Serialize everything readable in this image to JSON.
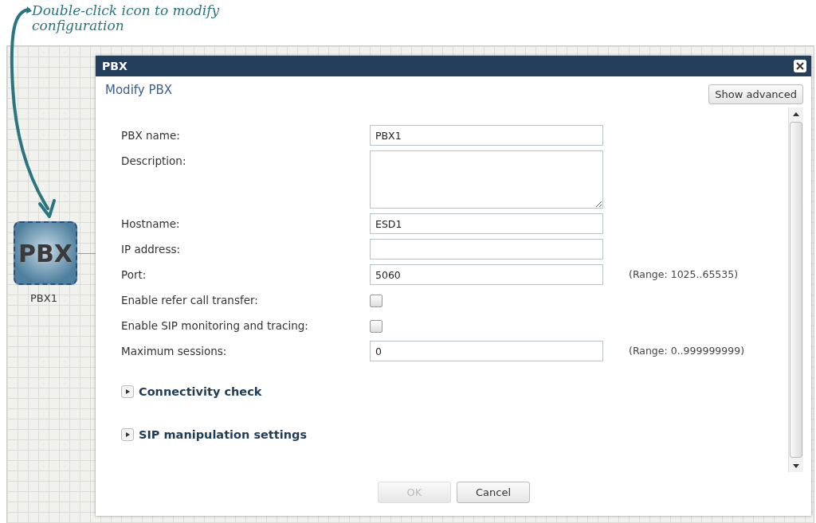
{
  "annotation": {
    "text": "Double-click icon to modify configuration"
  },
  "node": {
    "label": "PBX",
    "name": "PBX1"
  },
  "dialog": {
    "title": "PBX",
    "heading": "Modify PBX",
    "advanced_button": "Show advanced",
    "fields": [
      {
        "kind": "text",
        "label": "PBX name:",
        "value": "PBX1"
      },
      {
        "kind": "textarea",
        "label": "Description:"
      },
      {
        "kind": "text",
        "label": "Hostname:",
        "value": "ESD1"
      },
      {
        "kind": "text",
        "label": "IP address:"
      },
      {
        "kind": "text",
        "label": "Port:",
        "value": "5060",
        "hint": "(Range: 1025..65535)"
      },
      {
        "kind": "checkbox",
        "label": "Enable refer call transfer:",
        "checked": false
      },
      {
        "kind": "checkbox",
        "label": "Enable SIP monitoring and tracing:",
        "checked": false
      },
      {
        "kind": "text",
        "label": "Maximum sessions:",
        "value": "0",
        "hint": "(Range: 0..999999999)"
      }
    ],
    "sections": [
      {
        "title": "Connectivity check",
        "expanded": false
      },
      {
        "title": "SIP manipulation settings",
        "expanded": false
      }
    ],
    "buttons": [
      {
        "label": "OK",
        "disabled": true
      },
      {
        "label": "Cancel",
        "disabled": false
      }
    ]
  }
}
